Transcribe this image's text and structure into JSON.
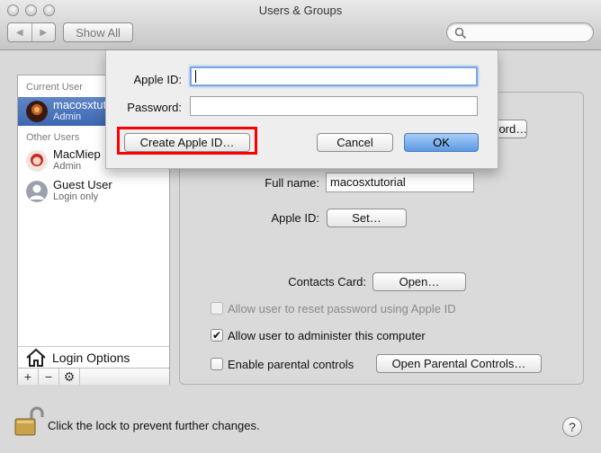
{
  "window": {
    "title": "Users & Groups"
  },
  "toolbar": {
    "show_all": "Show All",
    "back_icon": "back-arrow-icon",
    "forward_icon": "forward-arrow-icon",
    "search_placeholder": ""
  },
  "sidebar": {
    "current_user_header": "Current User",
    "current_user": {
      "name": "macosxtutorial",
      "role": "Admin"
    },
    "other_users_header": "Other Users",
    "other_users": [
      {
        "name": "MacMiep",
        "role": "Admin"
      },
      {
        "name": "Guest User",
        "role": "Login only"
      }
    ],
    "login_options": "Login Options",
    "buttons": {
      "add": "+",
      "remove": "−",
      "action": "⚙"
    }
  },
  "main": {
    "change_password": "Change Password…",
    "full_name_label": "Full name:",
    "full_name_value": "macosxtutorial",
    "apple_id_label": "Apple ID:",
    "apple_id_button": "Set…",
    "contacts_card_label": "Contacts Card:",
    "contacts_card_button": "Open…",
    "options": [
      {
        "label": "Allow user to reset password using Apple ID",
        "checked": false,
        "enabled": false
      },
      {
        "label": "Allow user to administer this computer",
        "checked": true,
        "enabled": true
      },
      {
        "label": "Enable parental controls",
        "checked": false,
        "enabled": true
      }
    ],
    "parental_controls_button": "Open Parental Controls…"
  },
  "sheet": {
    "apple_id_label": "Apple ID:",
    "apple_id_value": "",
    "password_label": "Password:",
    "password_value": "",
    "create_button": "Create Apple ID…",
    "cancel_button": "Cancel",
    "ok_button": "OK",
    "highlight_color": "#ff0000"
  },
  "footer": {
    "lock_text": "Click the lock to prevent further changes.",
    "help": "?"
  }
}
